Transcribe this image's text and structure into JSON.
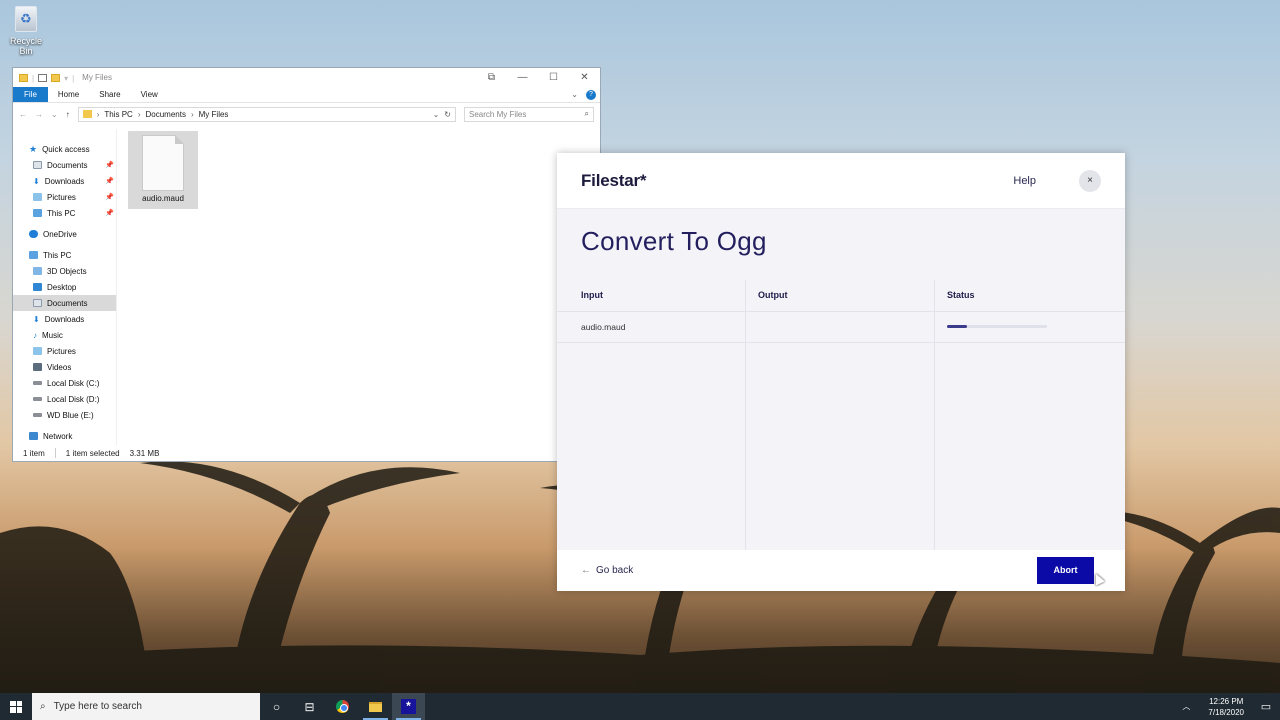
{
  "desktop": {
    "recycle_bin_label": "Recycle Bin"
  },
  "explorer": {
    "title": "My Files",
    "ribbon_tabs": [
      "File",
      "Home",
      "Share",
      "View"
    ],
    "breadcrumb": [
      "This PC",
      "Documents",
      "My Files"
    ],
    "search_placeholder": "Search My Files",
    "nav": {
      "quick_access": "Quick access",
      "qa_items": [
        "Documents",
        "Downloads",
        "Pictures",
        "This PC"
      ],
      "onedrive": "OneDrive",
      "this_pc": "This PC",
      "pc_items": [
        "3D Objects",
        "Desktop",
        "Documents",
        "Downloads",
        "Music",
        "Pictures",
        "Videos",
        "Local Disk (C:)",
        "Local Disk (D:)",
        "WD Blue (E:)"
      ],
      "network": "Network"
    },
    "file_name": "audio.maud",
    "status": {
      "count": "1 item",
      "selected": "1 item selected",
      "size": "3.31 MB"
    }
  },
  "filestar": {
    "logo": "Filestar*",
    "help": "Help",
    "close_symbol": "×",
    "title": "Convert To Ogg",
    "columns": [
      "Input",
      "Output",
      "Status"
    ],
    "rows": [
      {
        "input": "audio.maud",
        "output": "",
        "progress": 0.2
      }
    ],
    "go_back": "Go back",
    "abort": "Abort",
    "accent_color": "#0c0aa6"
  },
  "taskbar": {
    "search_placeholder": "Type here to search",
    "time": "12:26 PM",
    "date": "7/18/2020"
  }
}
